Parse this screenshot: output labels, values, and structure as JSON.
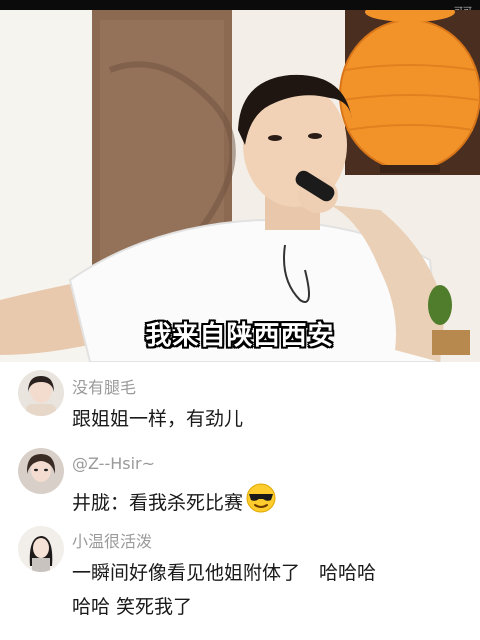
{
  "watermark": "可可",
  "video": {
    "subtitle": "我来自陕西西安"
  },
  "comments": [
    {
      "username": "没有腿毛",
      "text": "跟姐姐一样，有劲儿"
    },
    {
      "username": "@Z--Hsir~",
      "text": "井胧：看我杀死比赛",
      "emoji": "sunglasses-face-icon"
    },
    {
      "username": "小温很活泼",
      "text_line1": "一瞬间好像看见他姐附体了　哈哈哈",
      "text_line2": "哈哈 笑死我了"
    }
  ]
}
